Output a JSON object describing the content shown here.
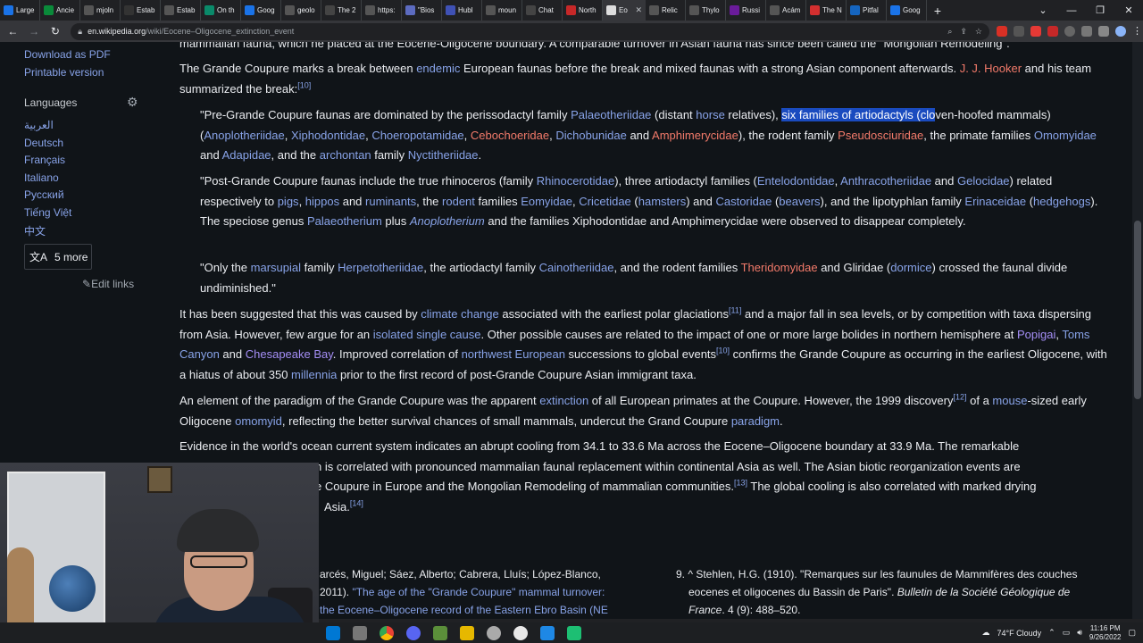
{
  "browser": {
    "tabs": [
      {
        "title": "Large",
        "color": "#1a73e8",
        "icon": "globe-icon"
      },
      {
        "title": "Ancie",
        "color": "#0a8a3a",
        "icon": "plus-icon"
      },
      {
        "title": "mjoln",
        "color": "#555",
        "icon": "globe-icon"
      },
      {
        "title": "Estab",
        "color": "#333",
        "icon": "w-icon"
      },
      {
        "title": "Estab",
        "color": "#555",
        "icon": "globe-icon"
      },
      {
        "title": "On th",
        "color": "#0a8a6a",
        "icon": "globe-icon"
      },
      {
        "title": "Goog",
        "color": "#1a73e8",
        "icon": "google-icon"
      },
      {
        "title": "geolo",
        "color": "#555",
        "icon": "globe-icon"
      },
      {
        "title": "The 2",
        "color": "#444",
        "icon": "globe-icon"
      },
      {
        "title": "https:",
        "color": "#555",
        "icon": "globe-icon"
      },
      {
        "title": "\"Bios",
        "color": "#5c6bc0",
        "icon": "doc-icon"
      },
      {
        "title": "Hubl",
        "color": "#3f51b5",
        "icon": "globe-icon"
      },
      {
        "title": "moun",
        "color": "#555",
        "icon": "globe-icon"
      },
      {
        "title": "Chat",
        "color": "#444",
        "icon": "doc-icon"
      },
      {
        "title": "North",
        "color": "#c62828",
        "icon": "doc-icon"
      },
      {
        "title": "Eo",
        "color": "#ddd",
        "icon": "w-icon"
      },
      {
        "title": "Relic",
        "color": "#555",
        "icon": "w-icon"
      },
      {
        "title": "Thylo",
        "color": "#555",
        "icon": "w-icon"
      },
      {
        "title": "Russi",
        "color": "#6a1b9a",
        "icon": "y-icon"
      },
      {
        "title": "Acám",
        "color": "#555",
        "icon": "w-icon"
      },
      {
        "title": "The N",
        "color": "#d32f2f",
        "icon": "s-icon"
      },
      {
        "title": "Pitfal",
        "color": "#1565c0",
        "icon": "globe-icon"
      },
      {
        "title": "Goog",
        "color": "#1a73e8",
        "icon": "google-icon"
      }
    ],
    "active_tab_index": 15,
    "new_tab": "+",
    "url_domain": "en.wikipedia.org",
    "url_path": "/wiki/Eocene–Oligocene_extinction_event"
  },
  "sidebar": {
    "tools": [
      "Download as PDF",
      "Printable version"
    ],
    "languages_heading": "Languages",
    "languages": [
      "العربية",
      "Deutsch",
      "Français",
      "Italiano",
      "Русский",
      "Tiếng Việt",
      "中文"
    ],
    "more_label": "5 more",
    "edit_links": "Edit links"
  },
  "article": {
    "top_fragment": "mammalian fauna, which he placed at the Eocene-Oligocene boundary. A comparable turnover in Asian fauna has since been called the \"Mongolian Remodeling\".",
    "p1": {
      "a": "The Grande Coupure marks a break between ",
      "endemic": "endemic",
      "b": " European faunas before the break and mixed faunas with a strong Asian component afterwards. ",
      "hooker": "J. J. Hooker",
      "c": " and his team summarized the break:",
      "ref": "[10]"
    },
    "q1": {
      "a": "\"Pre-Grande Coupure faunas are dominated by the perissodactyl family ",
      "palaeotheriidae": "Palaeotheriidae",
      "b": " (distant ",
      "horse": "horse",
      "c": " relatives), ",
      "hl1": "six families of artiodactyls (",
      "hl2": "clo",
      "d": "ven-hoofed mammals) (",
      "anoplo": "Anoplotheriidae",
      "xipho": "Xiphodontidae",
      "choero": "Choeropotamidae",
      "cebo": "Cebochoeridae",
      "dicho": "Dichobunidae",
      "and": " and ",
      "amphi": "Amphimerycidae",
      "e": "), the rodent family ",
      "pseudo": "Pseudosciuridae",
      "f": ", the primate families ",
      "omo": "Omomyidae",
      "adap": "Adapidae",
      "g": ", and the ",
      "archonta": "archontan",
      "h": " family ",
      "nycti": "Nyctitheriidae",
      "i": "."
    },
    "q2": {
      "a": "\"Post-Grande Coupure faunas include the true rhinoceros (family ",
      "rhino": "Rhinocerotidae",
      "b": "), three artiodactyl families (",
      "entelo": "Entelodontidae",
      "anthraco": "Anthracotheriidae",
      "and": " and ",
      "gelo": "Gelocidae",
      "c": ") related respectively to ",
      "pigs": "pigs",
      "hippos": "hippos",
      "rumi": "ruminants",
      "d": ", the ",
      "rodent": "rodent",
      "e": " families ",
      "eomy": "Eomyidae",
      "crice": "Cricetidae",
      "ham": "hamsters",
      "casto": "Castoridae",
      "beav": "beavers",
      "f": "), and the lipotyphlan family ",
      "erina": "Erinaceidae",
      "hedge": "hedgehogs",
      "g": "). The speciose genus ",
      "palaeo": "Palaeotherium",
      "h": " plus ",
      "anoplo": "Anoplotherium",
      "i": " and the families Xiphodontidae and Amphimerycidae were observed to disappear completely."
    },
    "q3": {
      "a": "\"Only the ",
      "mars": "marsupial",
      "b": " family ",
      "herpe": "Herpetotheriidae",
      "c": ", the artiodactyl family ",
      "caino": "Cainotheriidae",
      "d": ", and the rodent families ",
      "theri": "Theridomyidae",
      "e": " and Gliridae (",
      "dorm": "dormice",
      "f": ") crossed the faunal divide undiminished.\""
    },
    "p2": {
      "a": "It has been suggested that this was caused by ",
      "climate": "climate change",
      "b": " associated with the earliest polar glaciations",
      "ref11": "[11]",
      "c": " and a major fall in sea levels, or by competition with taxa dispersing from Asia. However, few argue for an ",
      "isolated": "isolated single cause",
      "d": ". Other possible causes are related to the impact of one or more large bolides in northern hemisphere at ",
      "popigai": "Popigai",
      "e": ", ",
      "toms": "Toms Canyon",
      "f": " and ",
      "chesa": "Chesapeake Bay",
      "g": ". Improved correlation of ",
      "nw": "northwest European",
      "h": " successions to global events",
      "ref10": "[10]",
      "i": " confirms the Grande Coupure as occurring in the earliest Oligocene, with a hiatus of about 350 ",
      "mill": "millennia",
      "j": " prior to the first record of post-Grande Coupure Asian immigrant taxa."
    },
    "p3": {
      "a": "An element of the paradigm of the Grande Coupure was the apparent ",
      "ext": "extinction",
      "b": " of all European primates at the Coupure. However, the 1999 discovery",
      "ref12": "[12]",
      "c": " of a ",
      "mouse": "mouse",
      "d": "-sized early Oligocene ",
      "omo": "omomyid",
      "e": ", reflecting the better survival chances of small mammals, undercut the Grand Coupure ",
      "para": "paradigm",
      "f": "."
    },
    "p4": {
      "line1": "Evidence in the world's ocean current system indicates an abrupt cooling from 34.1 to 33.6 Ma across the Eocene–Oligocene boundary at 33.9 Ma. The remarkable",
      "line2": "n is correlated with pronounced mammalian faunal replacement within continental Asia as well. The Asian biotic reorganization events are",
      "line3a": "e Coupure in Europe and the Mongolian Remodeling of mammalian communities.",
      "ref13": "[13]",
      "line3b": " The global cooling is also correlated with marked drying",
      "line4": "Asia.",
      "ref14": "[14]"
    },
    "refs_left": {
      "line1": "arcés, Miguel; Sáez, Alberto; Cabrera, Lluís; López-Blanco,",
      "line2a": "2011). ",
      "line2b": "\"The age of the \"Grande Coupure\" mammal turnover:",
      "line3": "the Eocene–Oligocene record of the Eastern Ebro Basin (NE"
    },
    "refs_right": {
      "num": "9. ^",
      "line1": "Stehlen, H.G. (1910). \"Remarques sur les faunules de Mammifères des couches",
      "line2a": "eocenes et oligocenes du Bassin de Paris\". ",
      "line2b": "Bulletin de la Société Géologique de",
      "line3a": "France",
      "line3b": ". 4 (9): 488–520."
    }
  },
  "taskbar": {
    "weather": "74°F  Cloudy",
    "time": "11:16 PM",
    "date": "9/26/2022"
  }
}
